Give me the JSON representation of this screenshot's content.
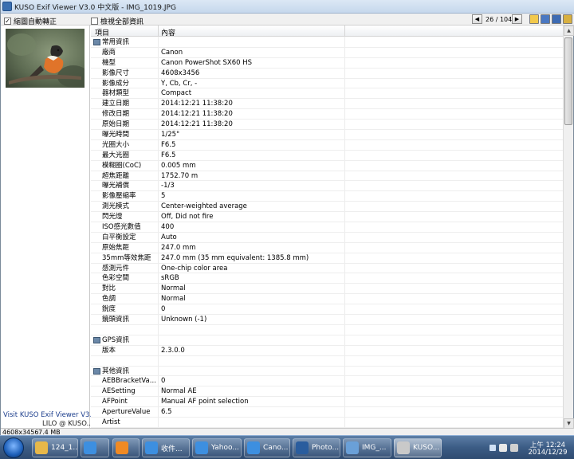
{
  "window": {
    "title": "KUSO Exif Viewer V3.0 中文版 - IMG_1019.JPG"
  },
  "toolbar": {
    "auto_rotate_label": "縮圖自動轉正",
    "auto_rotate_checked": true,
    "show_all_label": "檢視全部資訊",
    "show_all_checked": false,
    "page_indicator": "26 / 104"
  },
  "left_panel": {
    "visit_text": "Visit KUSO Exif Viewer V3.0",
    "author_text": "LILO @ KUSO..."
  },
  "table": {
    "col_item": "項目",
    "col_content": "內容",
    "rows": [
      {
        "type": "section",
        "key": "常用資訊",
        "value": ""
      },
      {
        "type": "row",
        "key": "廠商",
        "value": "Canon"
      },
      {
        "type": "row",
        "key": "機型",
        "value": "Canon PowerShot SX60 HS"
      },
      {
        "type": "row",
        "key": "影像尺寸",
        "value": "4608x3456"
      },
      {
        "type": "row",
        "key": "影像成分",
        "value": "Y, Cb, Cr, -"
      },
      {
        "type": "row",
        "key": "器材類型",
        "value": "Compact"
      },
      {
        "type": "row",
        "key": "建立日期",
        "value": "2014:12:21 11:38:20"
      },
      {
        "type": "row",
        "key": "修改日期",
        "value": "2014:12:21 11:38:20"
      },
      {
        "type": "row",
        "key": "原始日期",
        "value": "2014:12:21 11:38:20"
      },
      {
        "type": "row",
        "key": "曝光時間",
        "value": "1/25\""
      },
      {
        "type": "row",
        "key": "光圈大小",
        "value": "F6.5"
      },
      {
        "type": "row",
        "key": "最大光圈",
        "value": "F6.5"
      },
      {
        "type": "row",
        "key": "模糊圈(CoC)",
        "value": "0.005 mm"
      },
      {
        "type": "row",
        "key": "超焦距離",
        "value": "1752.70 m"
      },
      {
        "type": "row",
        "key": "曝光補償",
        "value": "-1/3"
      },
      {
        "type": "row",
        "key": "影像壓縮率",
        "value": "5"
      },
      {
        "type": "row",
        "key": "測光模式",
        "value": "Center-weighted average"
      },
      {
        "type": "row",
        "key": "閃光燈",
        "value": "Off, Did not fire"
      },
      {
        "type": "row",
        "key": "ISO感光數值",
        "value": "400"
      },
      {
        "type": "row",
        "key": "白平衡設定",
        "value": "Auto"
      },
      {
        "type": "row",
        "key": "原始焦距",
        "value": "247.0 mm"
      },
      {
        "type": "row",
        "key": "35mm等效焦距",
        "value": "247.0 mm (35 mm equivalent: 1385.8 mm)"
      },
      {
        "type": "row",
        "key": "感測元件",
        "value": "One-chip color area"
      },
      {
        "type": "row",
        "key": "色彩空間",
        "value": "sRGB"
      },
      {
        "type": "row",
        "key": "對比",
        "value": "Normal"
      },
      {
        "type": "row",
        "key": "色調",
        "value": "Normal"
      },
      {
        "type": "row",
        "key": "銳度",
        "value": "0"
      },
      {
        "type": "row",
        "key": "鏡頭資訊",
        "value": "Unknown (-1)"
      },
      {
        "type": "blank",
        "key": "",
        "value": ""
      },
      {
        "type": "section",
        "key": "GPS資訊",
        "value": ""
      },
      {
        "type": "row",
        "key": "版本",
        "value": "2.3.0.0"
      },
      {
        "type": "blank",
        "key": "",
        "value": ""
      },
      {
        "type": "section",
        "key": "其他資訊",
        "value": ""
      },
      {
        "type": "row",
        "key": "AEBBracketVa...",
        "value": "0"
      },
      {
        "type": "row",
        "key": "AESetting",
        "value": "Normal AE"
      },
      {
        "type": "row",
        "key": "AFPoint",
        "value": "Manual AF point selection"
      },
      {
        "type": "row",
        "key": "ApertureValue",
        "value": "6.5"
      },
      {
        "type": "row",
        "key": "Artist",
        "value": ""
      }
    ]
  },
  "status": {
    "dimensions": "4608x3456",
    "file_size": "7.4 MB"
  },
  "taskbar": {
    "items": [
      {
        "label": "124_1...",
        "icon": "folder-icon"
      },
      {
        "label": "",
        "icon": "ie-icon"
      },
      {
        "label": "",
        "icon": "media-player-icon"
      },
      {
        "label": "收件...",
        "icon": "ie-icon"
      },
      {
        "label": "Yahoo...",
        "icon": "ie-icon"
      },
      {
        "label": "Cano...",
        "icon": "ie-icon"
      },
      {
        "label": "Photo...",
        "icon": "photoshop-icon"
      },
      {
        "label": "IMG_...",
        "icon": "image-icon"
      },
      {
        "label": "KUSO...",
        "icon": "kuso-icon"
      }
    ],
    "clock_time": "上午 12:24",
    "clock_date": "2014/12/29"
  }
}
